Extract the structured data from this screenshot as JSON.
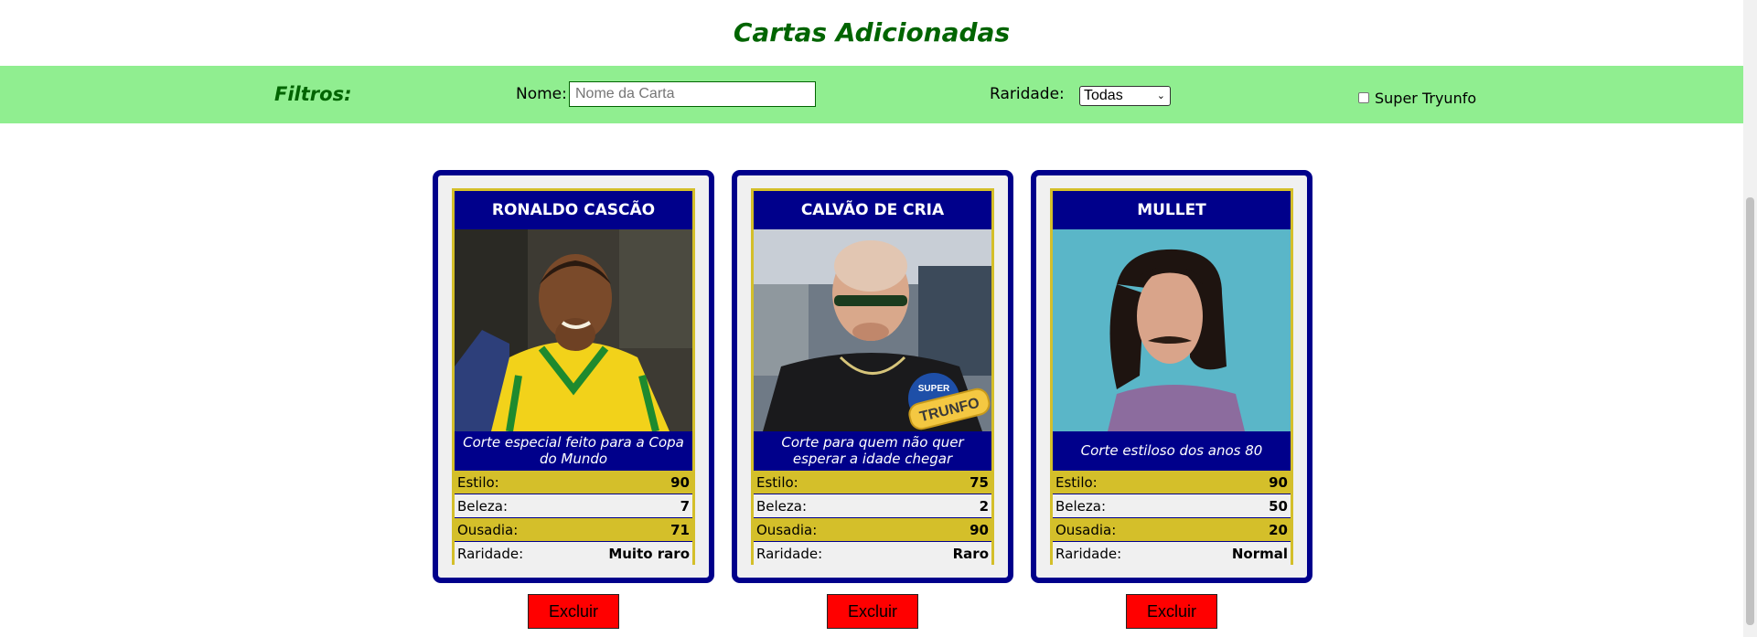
{
  "header": {
    "title": "Cartas Adicionadas"
  },
  "filters": {
    "title": "Filtros:",
    "name_label": "Nome:",
    "name_placeholder": "Nome da Carta",
    "name_value": "",
    "rarity_label": "Raridade:",
    "rarity_selected": "Todas",
    "trunfo_label": "Super Tryunfo",
    "trunfo_checked": false
  },
  "cards": [
    {
      "name": "RONALDO CASCÃO",
      "description": "Corte especial feito para a Copa do Mundo",
      "attributes": [
        {
          "label": "Estilo:",
          "value": "90"
        },
        {
          "label": "Beleza:",
          "value": "7"
        },
        {
          "label": "Ousadia:",
          "value": "71"
        },
        {
          "label": "Raridade:",
          "value": "Muito raro"
        }
      ],
      "super_trunfo": false,
      "delete_label": "Excluir"
    },
    {
      "name": "CALVÃO DE CRIA",
      "description": "Corte para quem não quer esperar a idade chegar",
      "attributes": [
        {
          "label": "Estilo:",
          "value": "75"
        },
        {
          "label": "Beleza:",
          "value": "2"
        },
        {
          "label": "Ousadia:",
          "value": "90"
        },
        {
          "label": "Raridade:",
          "value": "Raro"
        }
      ],
      "super_trunfo": true,
      "badge_top": "SUPER",
      "badge_main": "TRUNFO",
      "delete_label": "Excluir"
    },
    {
      "name": "MULLET",
      "description": "Corte estiloso dos anos 80",
      "attributes": [
        {
          "label": "Estilo:",
          "value": "90"
        },
        {
          "label": "Beleza:",
          "value": "50"
        },
        {
          "label": "Ousadia:",
          "value": "20"
        },
        {
          "label": "Raridade:",
          "value": "Normal"
        }
      ],
      "super_trunfo": false,
      "delete_label": "Excluir"
    }
  ],
  "colors": {
    "filter_bg": "#90ee90",
    "title_green": "#006400",
    "card_blue": "#00008b",
    "card_gold": "#d4bf2a",
    "delete_red": "#ff0000"
  }
}
